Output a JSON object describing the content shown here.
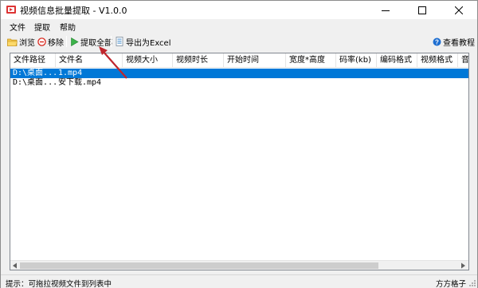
{
  "window": {
    "title": "视频信息批量提取 - V1.0.0",
    "minimize_icon": "minimize-icon",
    "maximize_icon": "maximize-icon",
    "close_icon": "close-icon"
  },
  "menubar": {
    "items": [
      {
        "label": "文件"
      },
      {
        "label": "提取"
      },
      {
        "label": "帮助"
      }
    ]
  },
  "toolbar": {
    "browse_label": "浏览",
    "remove_label": "移除",
    "extract_all_label": "提取全部",
    "export_excel_label": "导出为Excel",
    "tutorial_label": "查看教程"
  },
  "table": {
    "columns": [
      "文件路径",
      "文件名",
      "视频大小",
      "视频时长",
      "开始时间",
      "宽度*高度",
      "码率(kb)",
      "编码格式",
      "视频格式",
      "音频"
    ],
    "rows": [
      {
        "path": "D:\\桌面...",
        "name": "1.mp4",
        "selected": true
      },
      {
        "path": "D:\\桌面...",
        "name": "安下载.mp4",
        "selected": false
      }
    ]
  },
  "status": {
    "hint": "提示：可拖拉视频文件到列表中",
    "brand": "方方格子"
  },
  "colors": {
    "selection": "#0078d7",
    "arrow": "#c0262d"
  }
}
